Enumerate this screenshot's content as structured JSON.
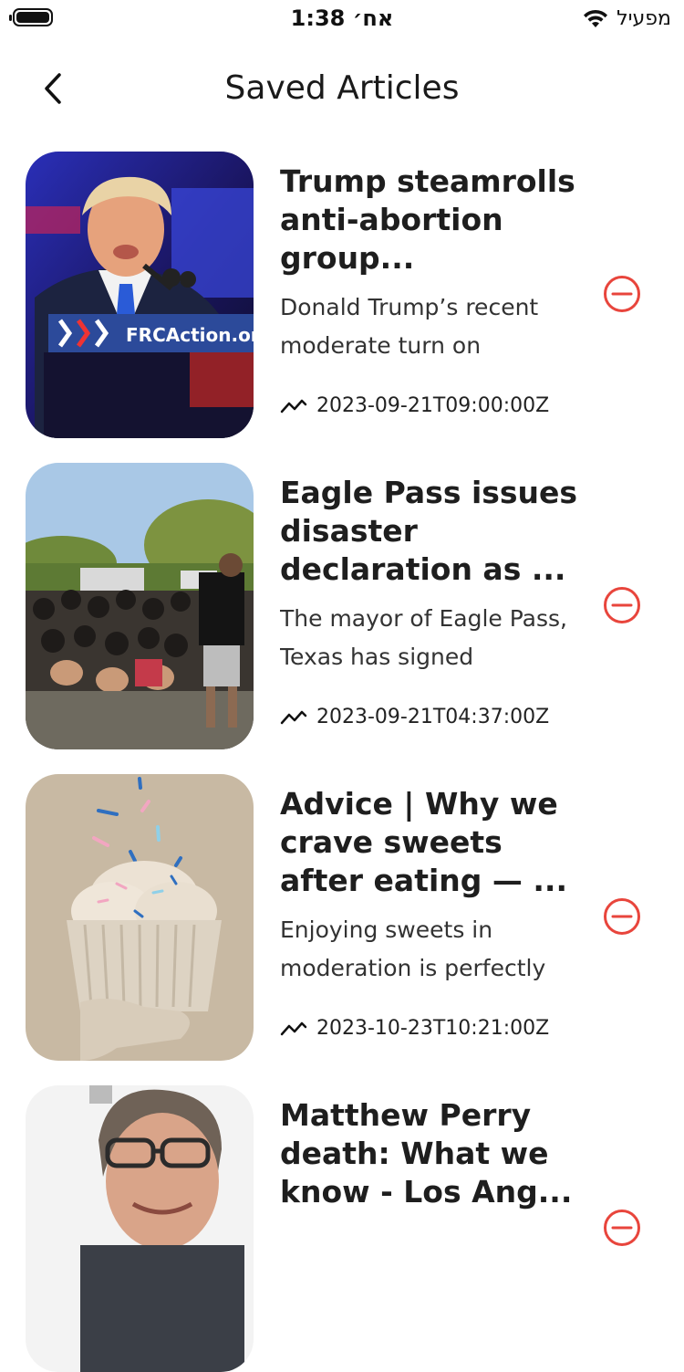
{
  "status": {
    "time": "1:38 אח׳",
    "carrier": "מפעיל"
  },
  "header": {
    "title": "Saved Articles"
  },
  "articles": [
    {
      "title": "Trump steamrolls anti-abortion group...",
      "description": "Donald Trump’s recent moderate turn on",
      "date": "2023-09-21T09:00:00Z"
    },
    {
      "title": "Eagle Pass issues disaster declaration as ...",
      "description": "The mayor of Eagle Pass, Texas has signed",
      "date": "2023-09-21T04:37:00Z"
    },
    {
      "title": "Advice | Why we crave sweets after eating — ...",
      "description": "Enjoying sweets in moderation is perfectly",
      "date": "2023-10-23T10:21:00Z"
    },
    {
      "title": "Matthew Perry death: What we know - Los Ang...",
      "description": "",
      "date": ""
    }
  ],
  "icons": {
    "back": "chevron-left-icon",
    "remove": "minus-circle-icon",
    "trend": "trending-icon"
  },
  "colors": {
    "remove": "#e8453c",
    "text": "#1e1e1e"
  }
}
